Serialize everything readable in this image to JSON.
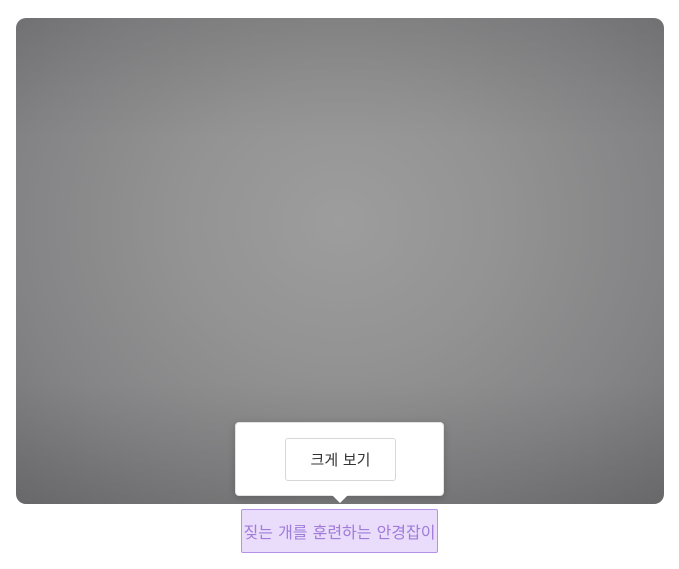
{
  "viewer": {
    "popover": {
      "view_large_label": "크게 보기"
    },
    "caption": "짖는 개를 훈련하는 안경잡이"
  }
}
